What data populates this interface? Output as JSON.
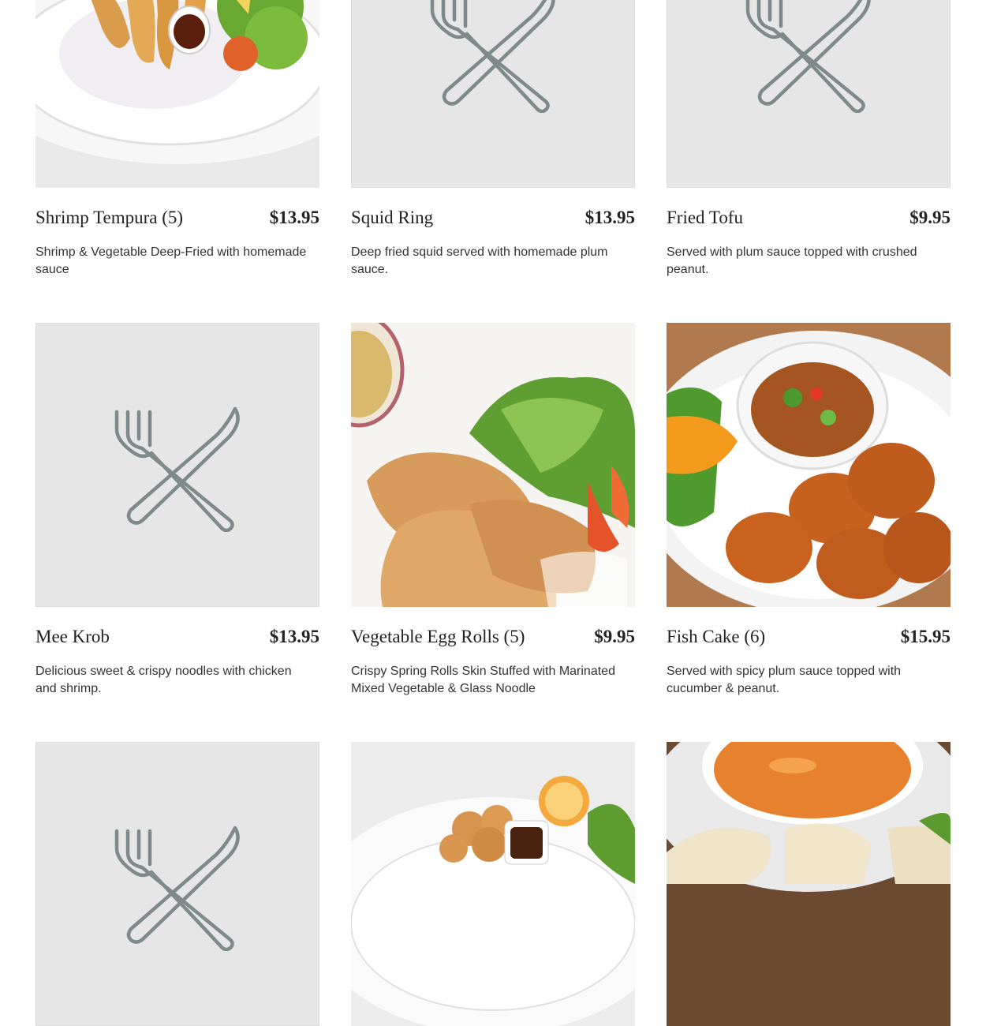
{
  "menu_items": [
    {
      "name": "Shrimp Tempura (5)",
      "price": "$13.95",
      "description": "Shrimp & Vegetable Deep-Fried with homemade sauce",
      "image": "shrimp-tempura-photo"
    },
    {
      "name": "Squid Ring",
      "price": "$13.95",
      "description": "Deep fried squid served with homemade plum sauce.",
      "image": "placeholder-fork-knife-icon"
    },
    {
      "name": "Fried Tofu",
      "price": "$9.95",
      "description": "Served with plum sauce topped with crushed peanut.",
      "image": "placeholder-fork-knife-icon"
    },
    {
      "name": "Mee Krob",
      "price": "$13.95",
      "description": "Delicious sweet & crispy noodles with chicken and shrimp.",
      "image": "placeholder-fork-knife-icon"
    },
    {
      "name": "Vegetable Egg Rolls (5)",
      "price": "$9.95",
      "description": "Crispy Spring Rolls Skin Stuffed with Marinated Mixed Vegetable & Glass Noodle",
      "image": "egg-rolls-photo"
    },
    {
      "name": "Fish Cake (6)",
      "price": "$15.95",
      "description": "Served with spicy plum sauce topped with cucumber & peanut.",
      "image": "fish-cake-photo"
    },
    {
      "image": "placeholder-fork-knife-icon"
    },
    {
      "image": "fried-chicken-photo"
    },
    {
      "image": "crab-rangoon-with-sauce-photo"
    }
  ],
  "colors": {
    "placeholder_bg": "#e6e6e6",
    "icon_stroke": "#7d8a89"
  }
}
